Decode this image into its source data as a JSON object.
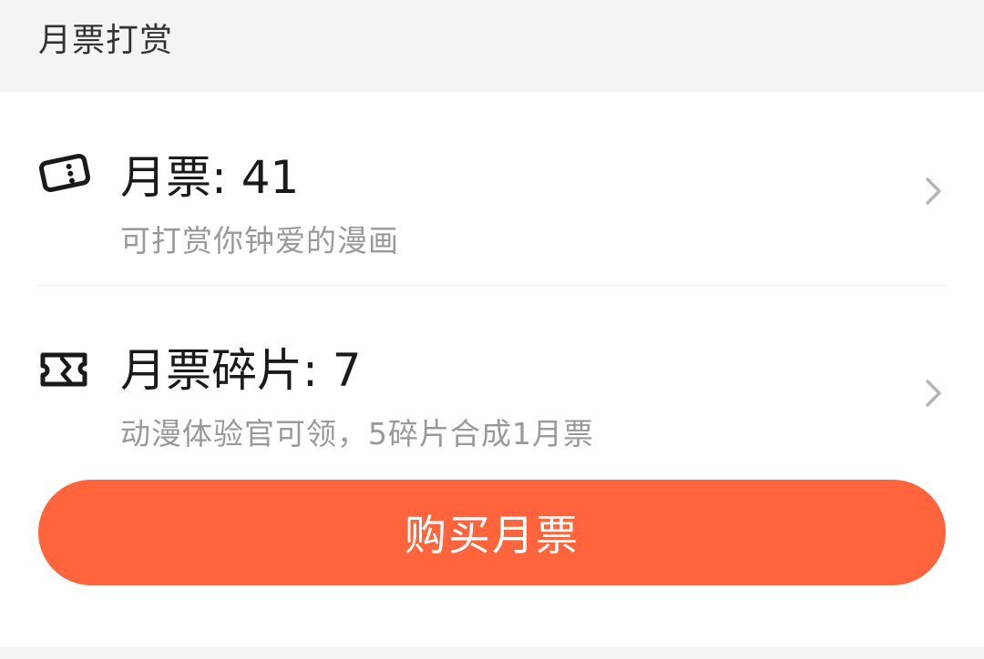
{
  "header": {
    "title": "月票打赏"
  },
  "monthly_ticket": {
    "icon": "ticket-icon",
    "title": "月票: 41",
    "subtitle": "可打赏你钟爱的漫画"
  },
  "ticket_fragment": {
    "icon": "ticket-fragment-icon",
    "title": "月票碎片: 7",
    "subtitle": "动漫体验官可领，5碎片合成1月票"
  },
  "buy_button": {
    "label": "购买月票"
  },
  "colors": {
    "accent": "#ff643c",
    "section_bg": "#f4f4f4",
    "title_text": "#1a1a1a",
    "secondary_text": "#999999"
  }
}
